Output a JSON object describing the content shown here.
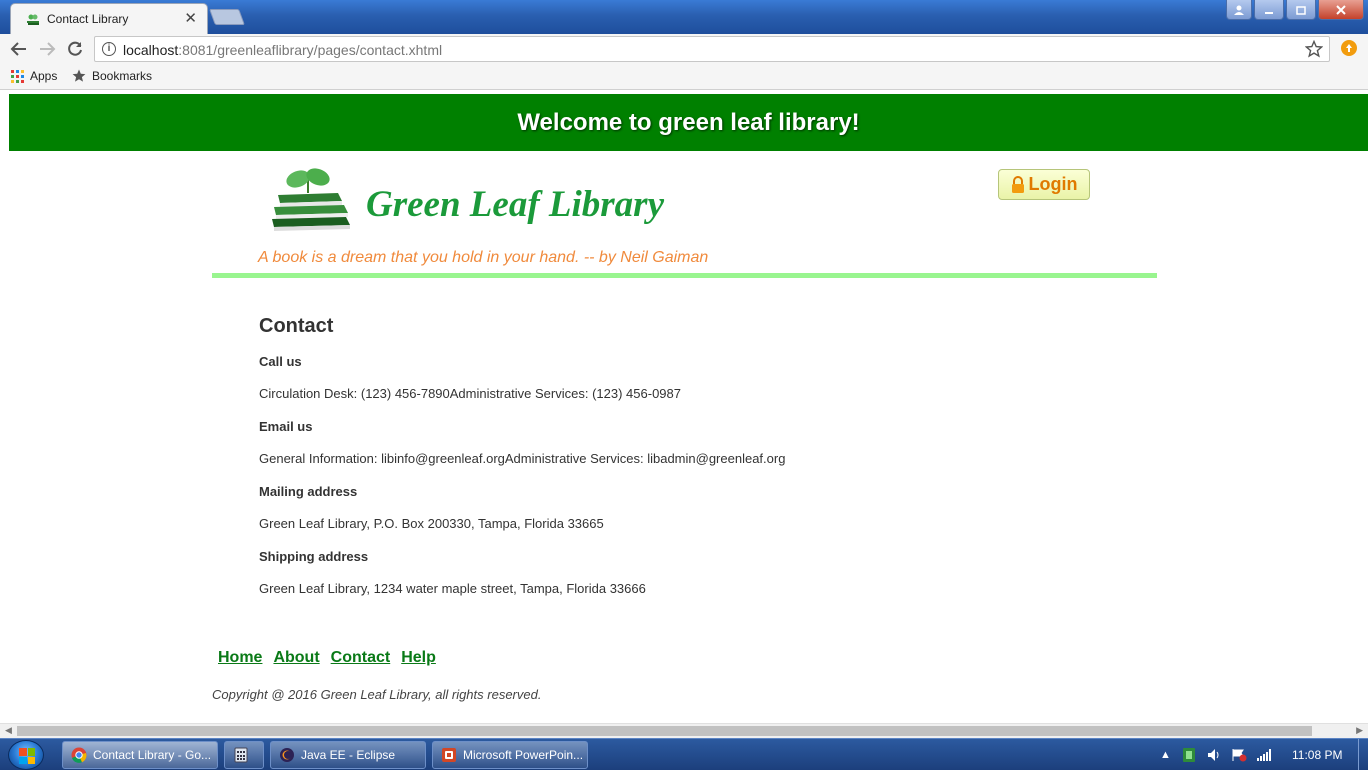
{
  "browser": {
    "tab_title": "Contact Library",
    "tab_close": "✕",
    "url_host": "localhost",
    "url_rest": ":8081/greenleaflibrary/pages/contact.xhtml",
    "bookmarks": [
      {
        "label": "Apps",
        "icon": "apps-grid-icon"
      },
      {
        "label": "Bookmarks",
        "icon": "star-icon"
      }
    ]
  },
  "page": {
    "banner": "Welcome to green leaf library!",
    "logo_text": "Green Leaf Library",
    "login_label": "Login",
    "quote": "A book is a dream that you hold in your hand. -- by Neil Gaiman",
    "heading": "Contact",
    "sections": [
      {
        "label": "Call us",
        "value": "Circulation Desk: (123) 456-7890Administrative Services: (123) 456-0987"
      },
      {
        "label": "Email us",
        "value": "General Information: libinfo@greenleaf.orgAdministrative Services: libadmin@greenleaf.org"
      },
      {
        "label": "Mailing address",
        "value": "Green Leaf Library, P.O. Box 200330, Tampa, Florida 33665"
      },
      {
        "label": "Shipping address",
        "value": "Green Leaf Library, 1234 water maple street, Tampa, Florida 33666"
      }
    ],
    "footer_links": [
      "Home",
      "About",
      "Contact",
      "Help"
    ],
    "copyright": "Copyright @ 2016 Green Leaf Library, all rights reserved.",
    "colors": {
      "banner": "#008000",
      "quote": "#f08a3c",
      "rule": "#99f58f",
      "link": "#0a7a17",
      "logo": "#1b9a3a"
    }
  },
  "taskbar": {
    "tasks": [
      {
        "label": "Contact Library - Go...",
        "icon": "chrome-icon"
      },
      {
        "label": "",
        "icon": "calculator-icon"
      },
      {
        "label": "Java EE - Eclipse",
        "icon": "eclipse-icon"
      },
      {
        "label": "Microsoft PowerPoin...",
        "icon": "powerpoint-icon"
      }
    ],
    "clock": "11:08 PM"
  }
}
